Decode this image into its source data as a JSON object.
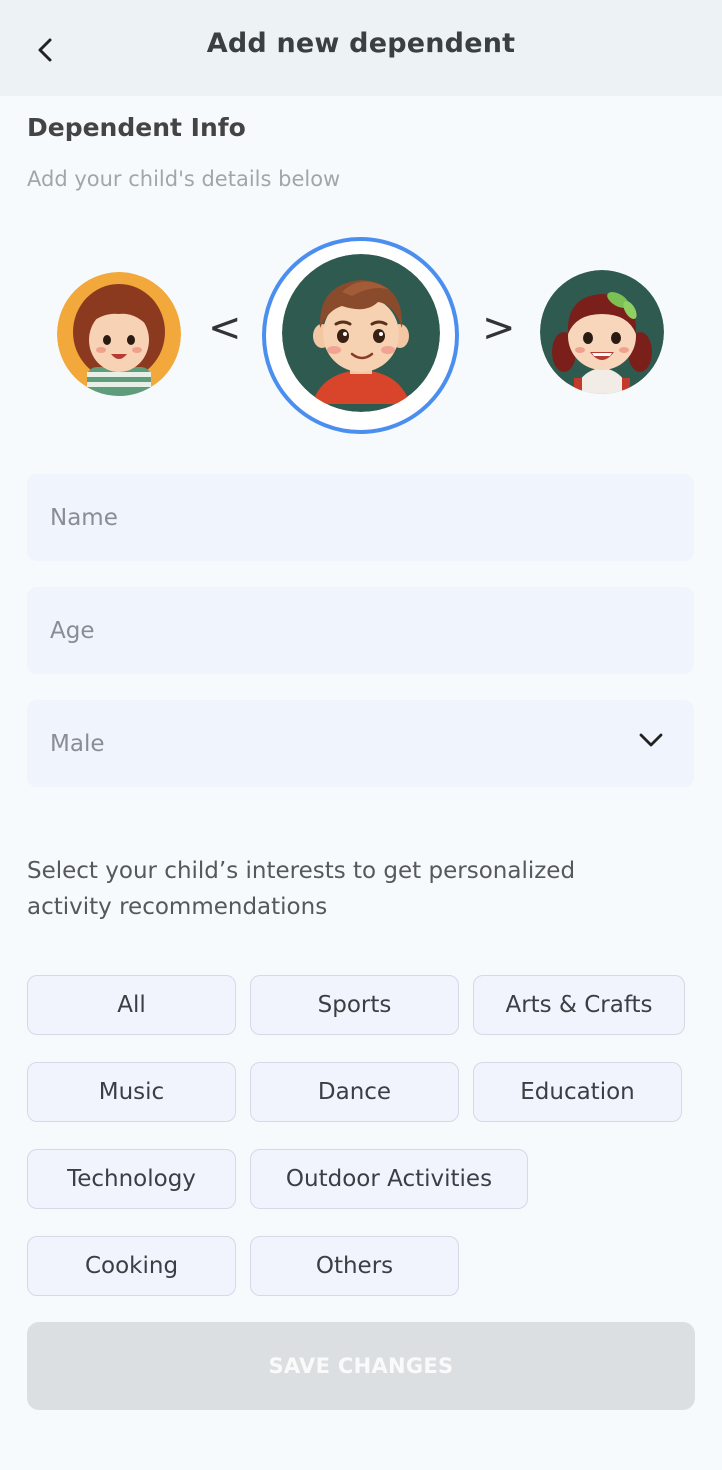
{
  "header": {
    "title": "Add new dependent",
    "back_icon": "chevron-left-icon"
  },
  "section": {
    "title": "Dependent Info",
    "subtitle": "Add your child's details below"
  },
  "avatar_carousel": {
    "prev_label": "<",
    "next_label": ">",
    "selected": "boy",
    "accent": "#4a8ff0"
  },
  "form": {
    "name_placeholder": "Name",
    "age_placeholder": "Age",
    "gender_value": "Male"
  },
  "interests": {
    "prompt": "Select your child’s interests to get personalized activity recommendations",
    "chips": [
      "All",
      "Sports",
      "Arts & Crafts",
      "Music",
      "Dance",
      "Education",
      "Technology",
      "Outdoor Activities",
      "Cooking",
      "Others"
    ]
  },
  "save_button": {
    "label": "SAVE CHANGES",
    "disabled": true
  }
}
